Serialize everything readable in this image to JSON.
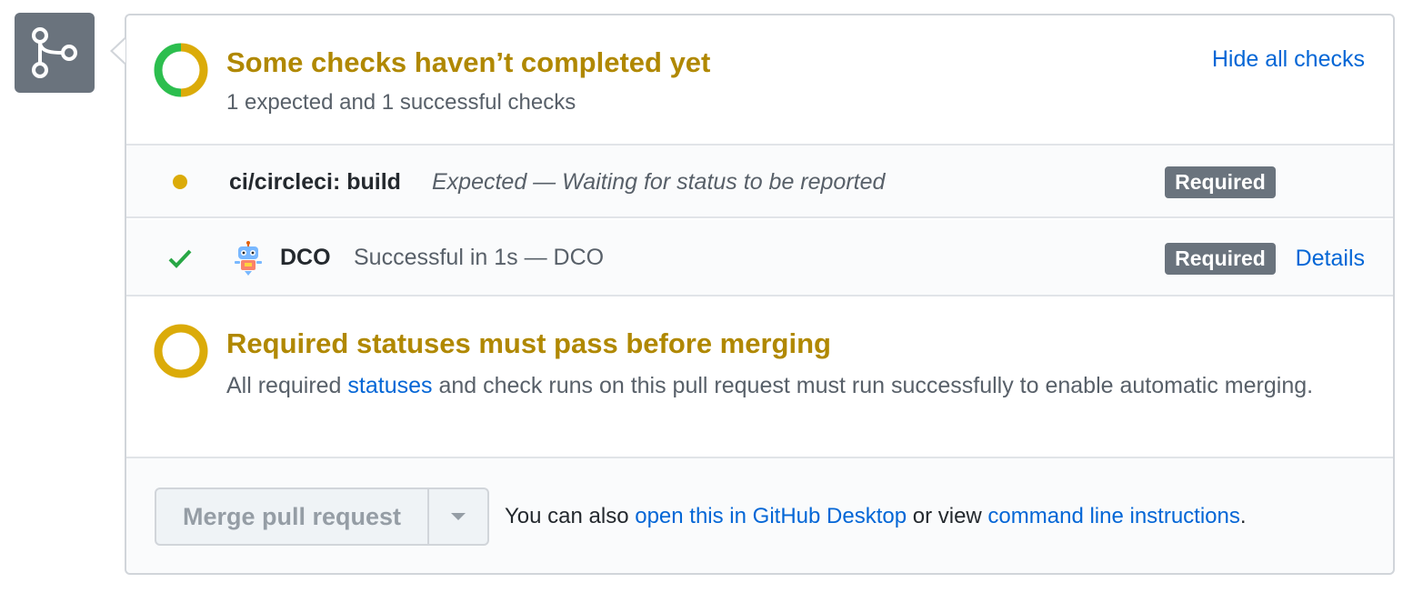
{
  "summary": {
    "title": "Some checks haven’t completed yet",
    "subtitle": "1 expected and 1 successful checks",
    "hide_link": "Hide all checks",
    "ring_colors": {
      "success": "#2cbe4e",
      "pending": "#dbab09"
    }
  },
  "checks": [
    {
      "status": "pending",
      "name": "ci/circleci: build",
      "description": "Expected — Waiting for status to be reported",
      "badge": "Required"
    },
    {
      "status": "success",
      "name": "DCO",
      "description": "Successful in 1s — DCO",
      "badge": "Required",
      "details_link": "Details",
      "avatar_icon": "robot-avatar-icon"
    }
  ],
  "requirement": {
    "title": "Required statuses must pass before merging",
    "desc_before": "All required ",
    "desc_link": "statuses",
    "desc_after": " and check runs on this pull request must run successfully to enable automatic merging."
  },
  "footer": {
    "merge_button": "Merge pull request",
    "text_prefix": "You can also ",
    "desktop_link": "open this in GitHub Desktop",
    "text_middle": " or view ",
    "cli_link": "command line instructions",
    "text_suffix": "."
  },
  "colors": {
    "accent_link": "#0366d6",
    "warning": "#b08800",
    "success": "#28a745",
    "badge_bg": "#6a737d"
  }
}
